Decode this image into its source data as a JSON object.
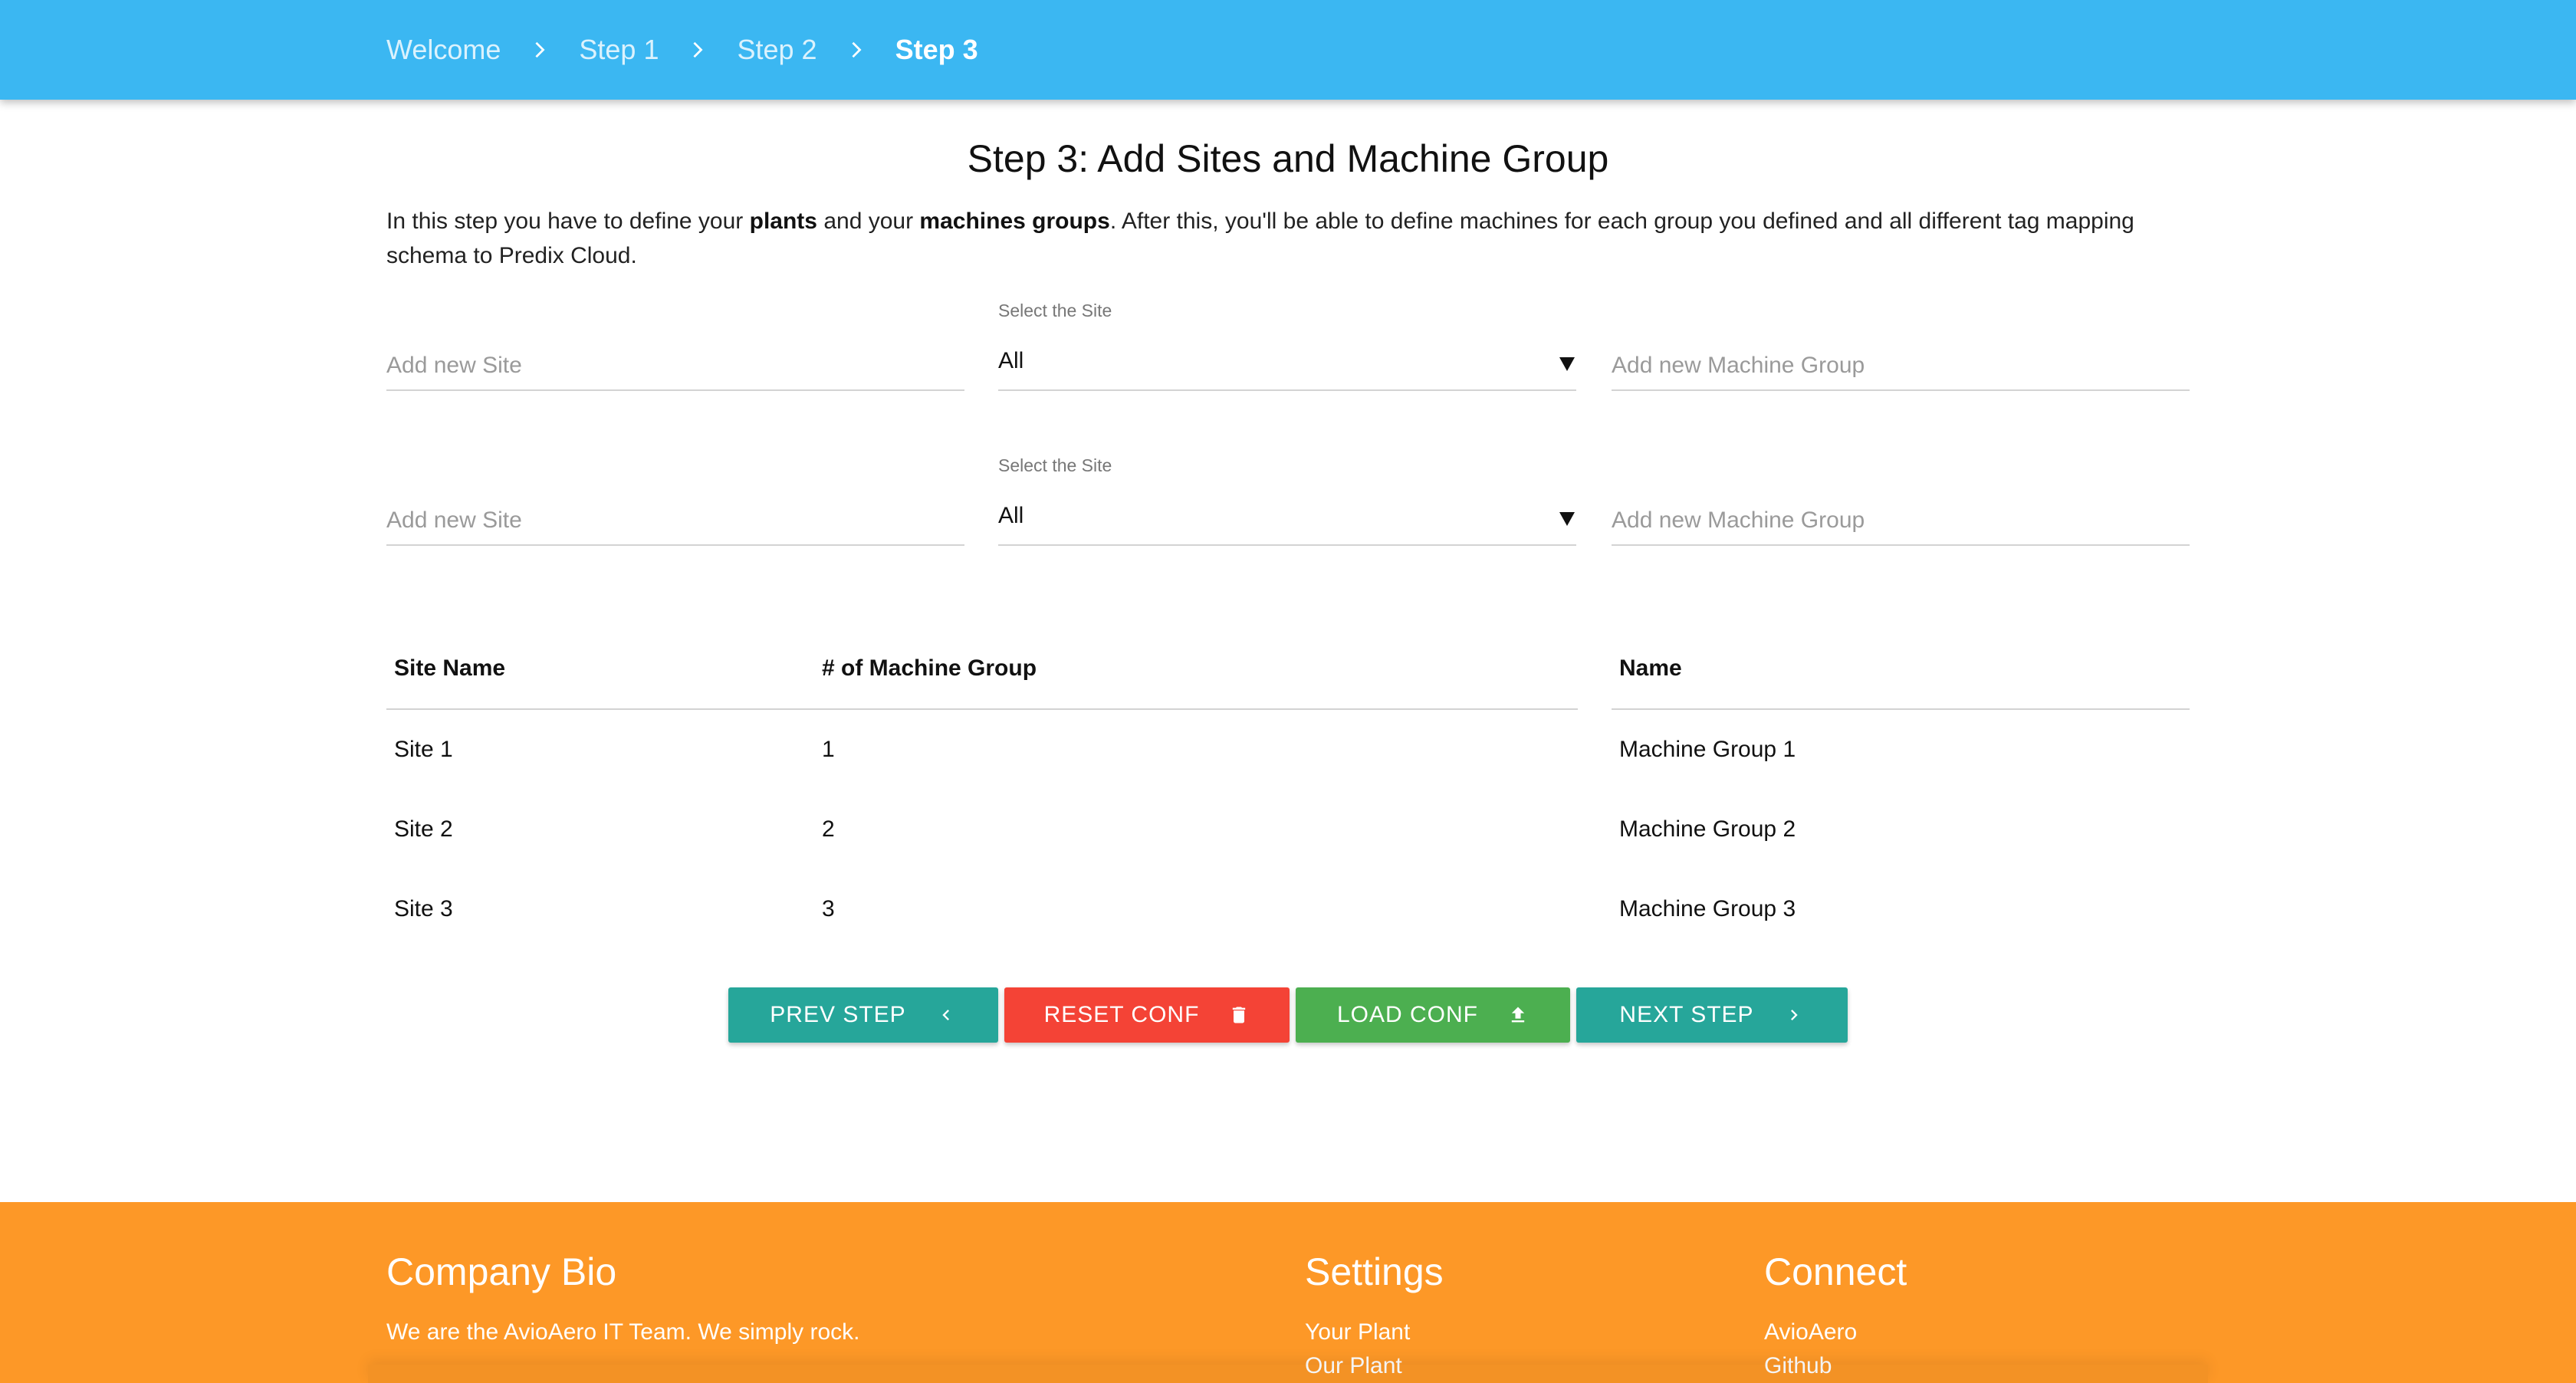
{
  "breadcrumb": {
    "items": [
      "Welcome",
      "Step 1",
      "Step 2",
      "Step 3"
    ],
    "active_index": 3
  },
  "main": {
    "title": "Step 3: Add Sites and Machine Group",
    "intro": {
      "part1": "In this step you have to define your ",
      "bold1": "plants",
      "part2": " and your ",
      "bold2": "machines groups",
      "part3": ". After this, you'll be able to define machines for each group you defined and all different tag mapping schema to Predix Cloud."
    },
    "form_rows": [
      {
        "site_placeholder": "Add new Site",
        "select_label": "Select the Site",
        "select_value": "All",
        "group_placeholder": "Add new Machine Group"
      },
      {
        "site_placeholder": "Add new Site",
        "select_label": "Select the Site",
        "select_value": "All",
        "group_placeholder": "Add new Machine Group"
      }
    ],
    "sites_table": {
      "headers": [
        "Site Name",
        "# of Machine Group"
      ],
      "rows": [
        [
          "Site 1",
          "1"
        ],
        [
          "Site 2",
          "2"
        ],
        [
          "Site 3",
          "3"
        ]
      ]
    },
    "groups_table": {
      "headers": [
        "Name"
      ],
      "rows": [
        [
          "Machine Group 1"
        ],
        [
          "Machine Group 2"
        ],
        [
          "Machine Group 3"
        ]
      ]
    },
    "buttons": {
      "prev": "PREV STEP",
      "reset": "RESET CONF",
      "load": "LOAD CONF",
      "next": "NEXT STEP"
    }
  },
  "footer": {
    "bio_title": "Company Bio",
    "bio_text": "We are the AvioAero IT Team. We simply rock.",
    "settings_title": "Settings",
    "settings_links": [
      "Your Plant",
      "Our Plant"
    ],
    "connect_title": "Connect",
    "connect_links": [
      "AvioAero",
      "Github"
    ]
  },
  "colors": {
    "header": "#3bb7f2",
    "teal": "#26a69a",
    "red": "#f44336",
    "green": "#4caf50",
    "footer": "#fd9827"
  },
  "icons": {
    "prev": "chevron-left-icon",
    "reset": "trash-icon",
    "load": "upload-icon",
    "next": "chevron-right-icon",
    "breadcrumb_separator": "chevron-right-icon",
    "select_caret": "caret-down-icon"
  }
}
